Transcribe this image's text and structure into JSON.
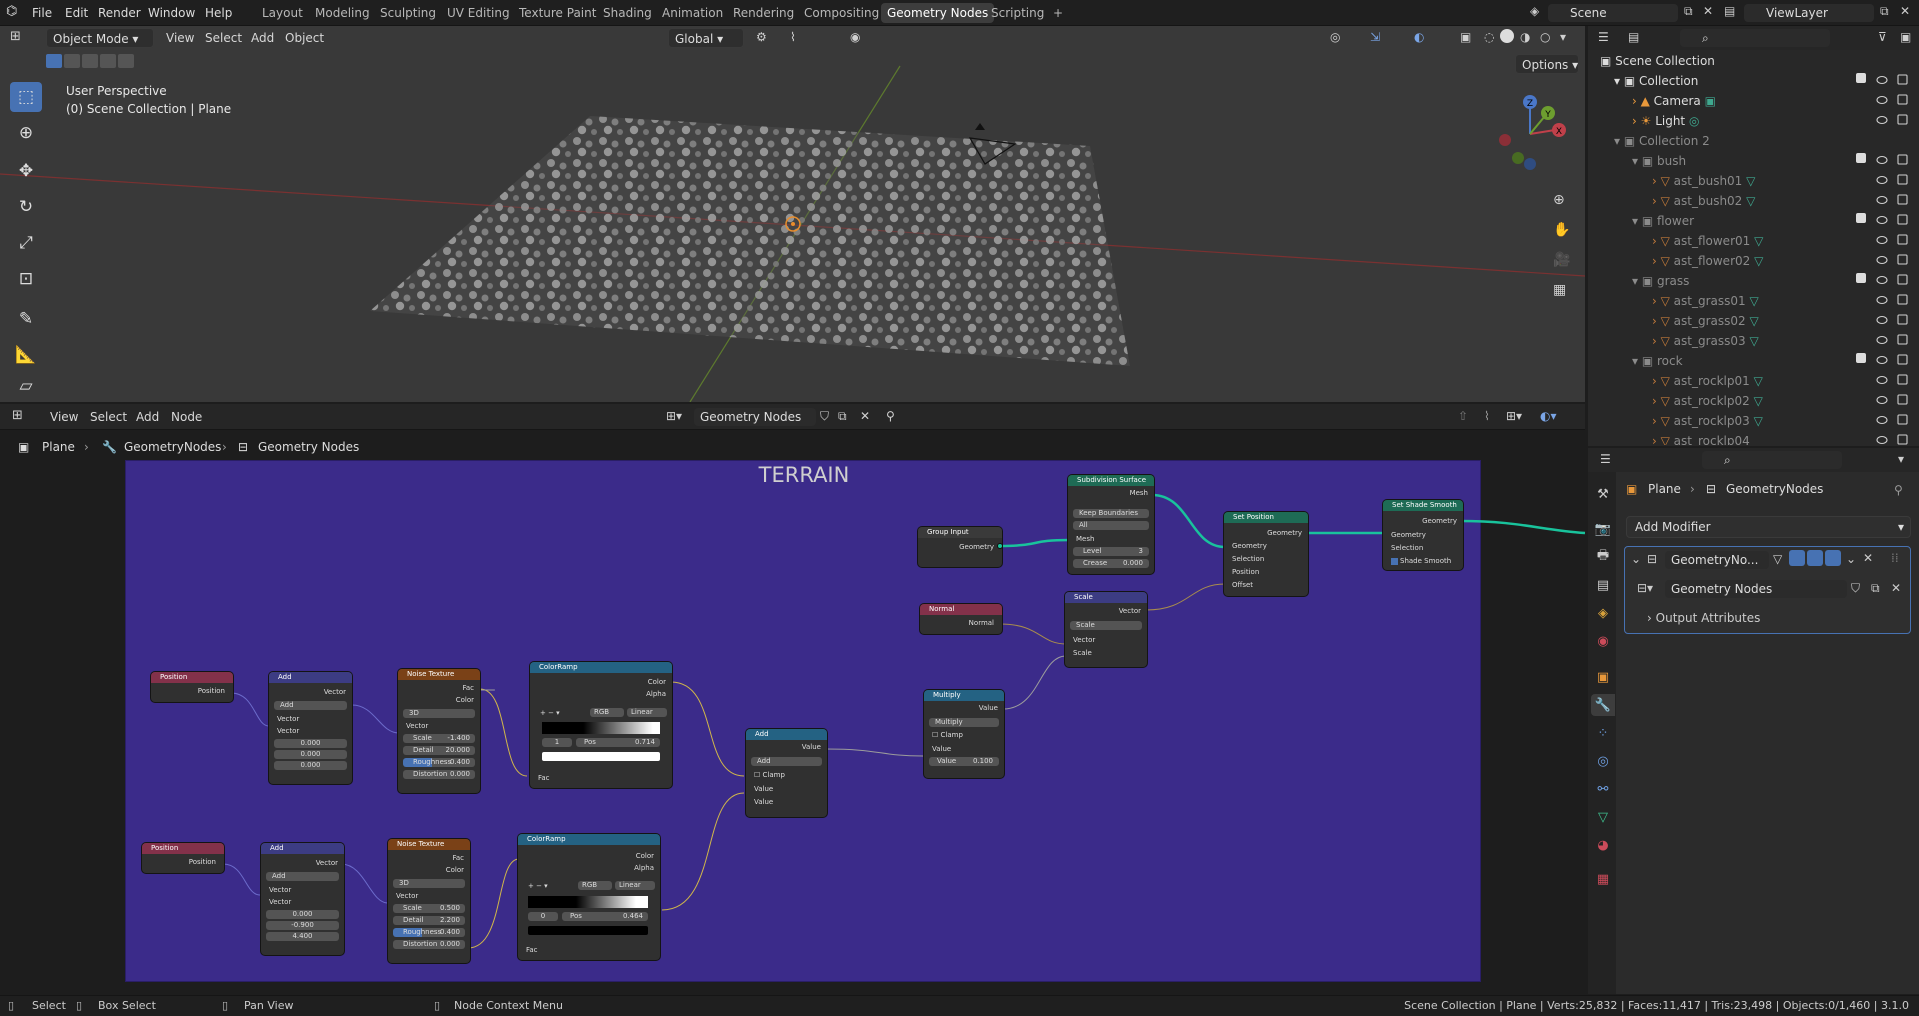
{
  "menu": {
    "file": "File",
    "edit": "Edit",
    "render": "Render",
    "window": "Window",
    "help": "Help"
  },
  "workspaces": [
    "Layout",
    "Modeling",
    "Sculpting",
    "UV Editing",
    "Texture Paint",
    "Shading",
    "Animation",
    "Rendering",
    "Compositing",
    "Geometry Nodes",
    "Scripting"
  ],
  "active_workspace": "Geometry Nodes",
  "add_workspace": "+",
  "scene": "Scene",
  "view_layer": "ViewLayer",
  "viewport": {
    "mode": "Object Mode",
    "view": "View",
    "select": "Select",
    "add": "Add",
    "object": "Object",
    "orientation": "Global",
    "options": "Options",
    "perspective": "User Perspective",
    "context": "(0) Scene Collection | Plane",
    "gizmo": {
      "x": "X",
      "y": "Y",
      "z": "Z"
    }
  },
  "outliner": {
    "root": "Scene Collection",
    "rows": [
      {
        "label": "Collection",
        "dim": false
      },
      {
        "label": "Camera",
        "dim": false
      },
      {
        "label": "Light",
        "dim": false
      },
      {
        "label": "Collection 2",
        "dim": true
      },
      {
        "label": "bush",
        "dim": true
      },
      {
        "label": "ast_bush01",
        "dim": true
      },
      {
        "label": "ast_bush02",
        "dim": true
      },
      {
        "label": "flower",
        "dim": true
      },
      {
        "label": "ast_flower01",
        "dim": true
      },
      {
        "label": "ast_flower02",
        "dim": true
      },
      {
        "label": "grass",
        "dim": true
      },
      {
        "label": "ast_grass01",
        "dim": true
      },
      {
        "label": "ast_grass02",
        "dim": true
      },
      {
        "label": "ast_grass03",
        "dim": true
      },
      {
        "label": "rock",
        "dim": true
      },
      {
        "label": "ast_rocklp01",
        "dim": true
      },
      {
        "label": "ast_rocklp02",
        "dim": true
      },
      {
        "label": "ast_rocklp03",
        "dim": true
      },
      {
        "label": "ast_rocklp04",
        "dim": true
      }
    ]
  },
  "node_editor": {
    "view": "View",
    "select": "Select",
    "add": "Add",
    "node": "Node",
    "tree_name": "Geometry Nodes",
    "breadcrumb": [
      "Plane",
      "GeometryNodes",
      "Geometry Nodes"
    ],
    "frame_label": "TERRAIN",
    "nodes": {
      "group_input": {
        "title": "Group Input",
        "out": "Geometry"
      },
      "subdiv": {
        "title": "Subdivision Surface",
        "mesh_out": "Mesh",
        "boundary": "Keep Boundaries",
        "uv": "All",
        "mesh_in": "Mesh",
        "level_label": "Level",
        "level": "3",
        "crease_label": "Crease",
        "crease": "0.000"
      },
      "set_position": {
        "title": "Set Position",
        "out": "Geometry",
        "in_geometry": "Geometry",
        "selection": "Selection",
        "position": "Position",
        "offset": "Offset"
      },
      "shade_smooth": {
        "title": "Set Shade Smooth",
        "out": "Geometry",
        "in_geometry": "Geometry",
        "selection": "Selection",
        "shade": "Shade Smooth"
      },
      "normal": {
        "title": "Normal",
        "out": "Normal"
      },
      "scale": {
        "title": "Scale",
        "out": "Vector",
        "op": "Scale",
        "vector": "Vector",
        "scale": "Scale"
      },
      "multiply": {
        "title": "Multiply",
        "out": "Value",
        "op": "Multiply",
        "clamp": "Clamp",
        "value": "Value",
        "value_label": "Value",
        "value_num": "0.100"
      },
      "add_math": {
        "title": "Add",
        "out": "Value",
        "op": "Add",
        "clamp": "Clamp",
        "v1": "Value",
        "v2": "Value"
      },
      "position1": {
        "title": "Position",
        "out": "Position"
      },
      "vadd1": {
        "title": "Add",
        "out": "Vector",
        "op": "Add",
        "v1": "Vector",
        "v2": "Vector",
        "x": "0.000",
        "y": "0.000",
        "z": "0.000"
      },
      "noise1": {
        "title": "Noise Texture",
        "fac": "Fac",
        "color": "Color",
        "dim": "3D",
        "vector": "Vector",
        "scale_label": "Scale",
        "scale": "-1.400",
        "detail_label": "Detail",
        "detail": "20.000",
        "rough_label": "Roughness",
        "rough": "0.400",
        "dist_label": "Distortion",
        "dist": "0.000"
      },
      "ramp1": {
        "title": "ColorRamp",
        "color": "Color",
        "alpha": "Alpha",
        "mode": "RGB",
        "interp": "Linear",
        "index": "1",
        "pos_label": "Pos",
        "pos": "0.714",
        "fac": "Fac"
      },
      "position2": {
        "title": "Position",
        "out": "Position"
      },
      "vadd2": {
        "title": "Add",
        "out": "Vector",
        "op": "Add",
        "v1": "Vector",
        "v2": "Vector",
        "x": "0.000",
        "y": "-0.900",
        "z": "4.400"
      },
      "noise2": {
        "title": "Noise Texture",
        "fac": "Fac",
        "color": "Color",
        "dim": "3D",
        "vector": "Vector",
        "scale_label": "Scale",
        "scale": "0.500",
        "detail_label": "Detail",
        "detail": "2.200",
        "rough_label": "Roughness",
        "rough": "0.400",
        "dist_label": "Distortion",
        "dist": "0.000"
      },
      "ramp2": {
        "title": "ColorRamp",
        "color": "Color",
        "alpha": "Alpha",
        "mode": "RGB",
        "interp": "Linear",
        "index": "0",
        "pos_label": "Pos",
        "pos": "0.464",
        "fac": "Fac"
      }
    }
  },
  "properties": {
    "breadcrumb": [
      "Plane",
      "GeometryNodes"
    ],
    "add_modifier": "Add Modifier",
    "modifier_name": "GeometryNo...",
    "node_group": "Geometry Nodes",
    "output_attributes": "Output Attributes"
  },
  "status": {
    "select": "Select",
    "box_select": "Box Select",
    "pan_view": "Pan View",
    "context_menu": "Node Context Menu",
    "stats": "Scene Collection | Plane | Verts:25,832 | Faces:11,417 | Tris:23,498 | Objects:0/1,460 | 3.1.0"
  },
  "colors": {
    "frame": "#3b2b8a",
    "accent": "#4772b3",
    "input_header": "#83314a",
    "vector_header": "#3c3c83",
    "texture_header": "#7a4117",
    "converter_header": "#246283",
    "geometry_header": "#1e6b55",
    "link_green": "#19c39c"
  }
}
